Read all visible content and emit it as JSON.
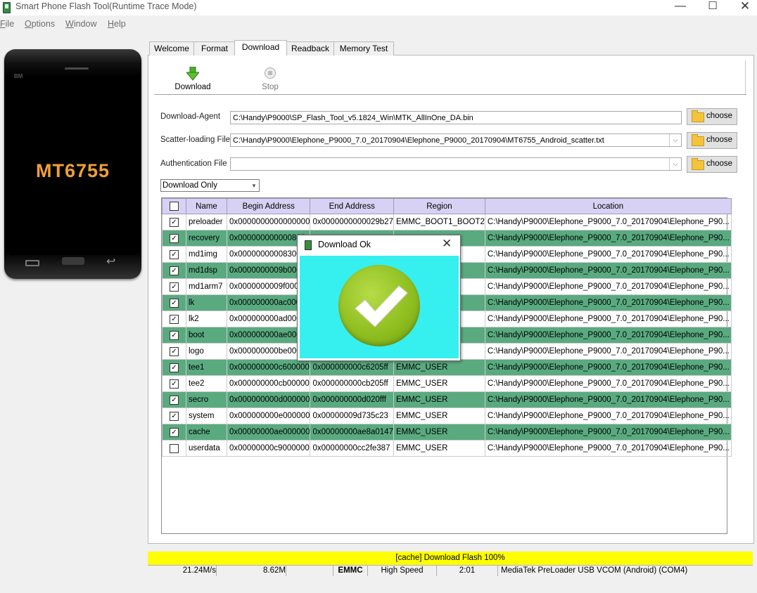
{
  "window": {
    "title": "Smart Phone Flash Tool(Runtime Trace Mode)"
  },
  "menu": [
    {
      "label": "File",
      "accel": "F"
    },
    {
      "label": "Options",
      "accel": "O"
    },
    {
      "label": "Window",
      "accel": "W"
    },
    {
      "label": "Help",
      "accel": "H"
    }
  ],
  "phone": {
    "brand": "BM",
    "chip": "MT6755"
  },
  "tabs": [
    {
      "label": "Welcome"
    },
    {
      "label": "Format"
    },
    {
      "label": "Download",
      "active": true
    },
    {
      "label": "Readback"
    },
    {
      "label": "Memory Test"
    }
  ],
  "toolbar": {
    "download_label": "Download",
    "stop_label": "Stop"
  },
  "fields": {
    "download_agent_label": "Download-Agent",
    "download_agent_value": "C:\\Handy\\P9000\\SP_Flash_Tool_v5.1824_Win\\MTK_AllInOne_DA.bin",
    "scatter_label": "Scatter-loading File",
    "scatter_value": "C:\\Handy\\P9000\\Elephone_P9000_7.0_20170904\\Elephone_P9000_20170904\\MT6755_Android_scatter.txt",
    "auth_label": "Authentication File",
    "auth_value": "",
    "choose_label": "choose"
  },
  "mode": {
    "selected": "Download Only"
  },
  "table": {
    "headers": [
      "Name",
      "Begin Address",
      "End Address",
      "Region",
      "Location"
    ],
    "rows": [
      {
        "checked": true,
        "name": "preloader",
        "begin": "0x0000000000000000",
        "end": "0x0000000000029b27",
        "region": "EMMC_BOOT1_BOOT2",
        "location": "C:\\Handy\\P9000\\Elephone_P9000_7.0_20170904\\Elephone_P90..."
      },
      {
        "checked": true,
        "name": "recovery",
        "begin": "0x000000000000800",
        "end": "",
        "region": "",
        "location": "C:\\Handy\\P9000\\Elephone_P9000_7.0_20170904\\Elephone_P90..."
      },
      {
        "checked": true,
        "name": "md1img",
        "begin": "0x00000000008300",
        "end": "",
        "region": "",
        "location": "C:\\Handy\\P9000\\Elephone_P9000_7.0_20170904\\Elephone_P90..."
      },
      {
        "checked": true,
        "name": "md1dsp",
        "begin": "0x0000000009b000",
        "end": "",
        "region": "",
        "location": "C:\\Handy\\P9000\\Elephone_P9000_7.0_20170904\\Elephone_P90..."
      },
      {
        "checked": true,
        "name": "md1arm7",
        "begin": "0x0000000009f000",
        "end": "",
        "region": "",
        "location": "C:\\Handy\\P9000\\Elephone_P9000_7.0_20170904\\Elephone_P90..."
      },
      {
        "checked": true,
        "name": "lk",
        "begin": "0x000000000ac000",
        "end": "",
        "region": "",
        "location": "C:\\Handy\\P9000\\Elephone_P9000_7.0_20170904\\Elephone_P90..."
      },
      {
        "checked": true,
        "name": "lk2",
        "begin": "0x000000000ad000",
        "end": "",
        "region": "",
        "location": "C:\\Handy\\P9000\\Elephone_P9000_7.0_20170904\\Elephone_P90..."
      },
      {
        "checked": true,
        "name": "boot",
        "begin": "0x000000000ae000",
        "end": "",
        "region": "",
        "location": "C:\\Handy\\P9000\\Elephone_P9000_7.0_20170904\\Elephone_P90..."
      },
      {
        "checked": true,
        "name": "logo",
        "begin": "0x000000000be000",
        "end": "",
        "region": "",
        "location": "C:\\Handy\\P9000\\Elephone_P9000_7.0_20170904\\Elephone_P90..."
      },
      {
        "checked": true,
        "name": "tee1",
        "begin": "0x000000000c600000",
        "end": "0x000000000c6205ff",
        "region": "EMMC_USER",
        "location": "C:\\Handy\\P9000\\Elephone_P9000_7.0_20170904\\Elephone_P90..."
      },
      {
        "checked": true,
        "name": "tee2",
        "begin": "0x000000000cb00000",
        "end": "0x000000000cb205ff",
        "region": "EMMC_USER",
        "location": "C:\\Handy\\P9000\\Elephone_P9000_7.0_20170904\\Elephone_P90..."
      },
      {
        "checked": true,
        "name": "secro",
        "begin": "0x000000000d000000",
        "end": "0x000000000d020fff",
        "region": "EMMC_USER",
        "location": "C:\\Handy\\P9000\\Elephone_P9000_7.0_20170904\\Elephone_P90..."
      },
      {
        "checked": true,
        "name": "system",
        "begin": "0x000000000e000000",
        "end": "0x00000009d735c23",
        "region": "EMMC_USER",
        "location": "C:\\Handy\\P9000\\Elephone_P9000_7.0_20170904\\Elephone_P90..."
      },
      {
        "checked": true,
        "name": "cache",
        "begin": "0x00000000ae000000",
        "end": "0x00000000ae8a0147",
        "region": "EMMC_USER",
        "location": "C:\\Handy\\P9000\\Elephone_P9000_7.0_20170904\\Elephone_P90..."
      },
      {
        "checked": false,
        "name": "userdata",
        "begin": "0x00000000c9000000",
        "end": "0x00000000cc2fe387",
        "region": "EMMC_USER",
        "location": "C:\\Handy\\P9000\\Elephone_P9000_7.0_20170904\\Elephone_P90..."
      }
    ]
  },
  "dialog": {
    "title": "Download Ok"
  },
  "progress": {
    "text": "[cache] Download Flash 100%",
    "percent": 100,
    "color": "#ffff00"
  },
  "status": {
    "speed": "21.24M/s",
    "size": "8.62M",
    "storage": "EMMC",
    "usb_speed": "High Speed",
    "time": "2:01",
    "port": "MediaTek PreLoader USB VCOM (Android) (COM4)"
  }
}
